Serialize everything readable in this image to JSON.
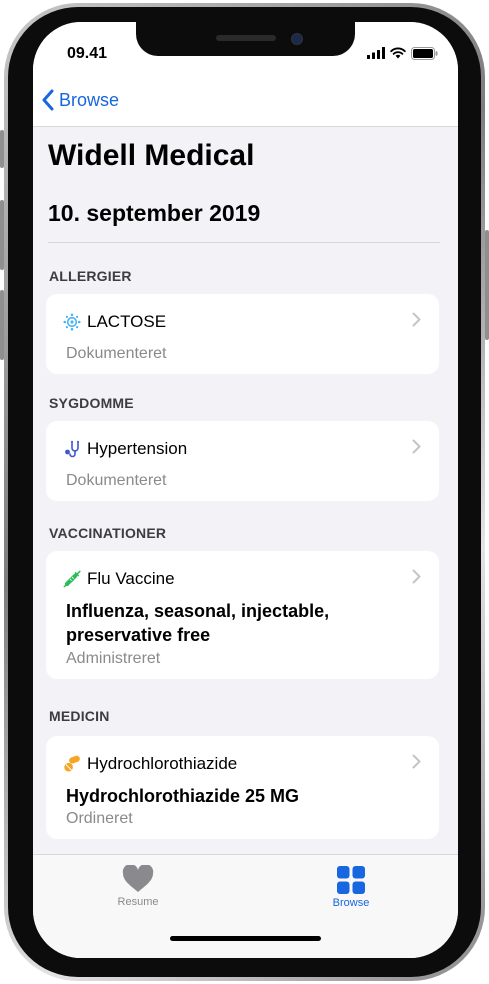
{
  "status": {
    "time": "09.41"
  },
  "nav": {
    "back_label": "Browse"
  },
  "page": {
    "title": "Widell Medical",
    "date": "10. september 2019"
  },
  "sections": {
    "allergies": {
      "header": "ALLERGIER",
      "item": {
        "name": "LACTOSE",
        "status": "Dokumenteret"
      }
    },
    "conditions": {
      "header": "SYGDOMME",
      "item": {
        "name": "Hypertension",
        "status": "Dokumenteret"
      }
    },
    "vaccinations": {
      "header": "VACCINATIONER",
      "item": {
        "name": "Flu Vaccine",
        "detail_line1": "Influenza, seasonal, injectable,",
        "detail_line2": "preservative free",
        "status": "Administreret"
      }
    },
    "medications": {
      "header": "MEDICIN",
      "item": {
        "name": "Hydrochlorothiazide",
        "detail": "Hydrochlorothiazide 25 MG",
        "status": "Ordineret"
      }
    }
  },
  "tabs": [
    {
      "label": "Resume",
      "icon": "heart-icon",
      "active": false
    },
    {
      "label": "Browse",
      "icon": "grid-icon",
      "active": true
    }
  ],
  "colors": {
    "accent": "#1866e0",
    "inactive_tab": "#8a8a8e",
    "background": "#f2f2f7",
    "allergy_icon": "#4ab3f4",
    "condition_icon": "#3f57c8",
    "vaccine_icon": "#2ebc5a",
    "medication_icon": "#f5a623"
  }
}
